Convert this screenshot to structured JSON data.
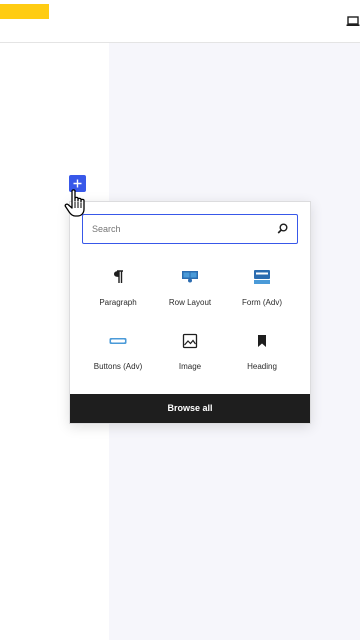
{
  "header": {
    "logo_color": "#ffcc12",
    "device_icon": "laptop-icon"
  },
  "inserter": {
    "toggle_icon": "plus-icon",
    "search": {
      "placeholder": "Search",
      "value": "",
      "icon": "search-icon"
    },
    "blocks": [
      {
        "label": "Paragraph",
        "icon": "paragraph-icon"
      },
      {
        "label": "Row Layout",
        "icon": "row-layout-icon"
      },
      {
        "label": "Form (Adv)",
        "icon": "form-icon"
      },
      {
        "label": "Buttons (Adv)",
        "icon": "buttons-icon"
      },
      {
        "label": "Image",
        "icon": "image-icon"
      },
      {
        "label": "Heading",
        "icon": "heading-icon"
      }
    ],
    "browse_all_label": "Browse all"
  },
  "colors": {
    "accent": "#3858e9",
    "dark": "#1e1e1e",
    "canvas": "#f6f6fb"
  }
}
